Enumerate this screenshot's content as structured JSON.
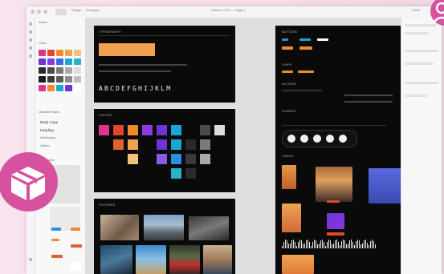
{
  "titlebar": {
    "tabs": [
      "Design",
      "Prototype"
    ],
    "document_title": "Outline UI Kit — Page 1",
    "zoom": "100%"
  },
  "left_panel": {
    "header": "Assets",
    "section_colors": "Colors",
    "section_text": "Character Styles",
    "text_samples": [
      "Body Copy",
      "Heading",
      "Subheading",
      "Caption"
    ],
    "section_components": "Components"
  },
  "boards": {
    "typography": {
      "title": "TYPOGRAPHY",
      "glyphs": "ABCDEFGHIJKLM"
    },
    "colors": {
      "title": "COLORS"
    },
    "pictures": {
      "title": "PICTURES"
    },
    "components": {
      "title": "BUTTONS",
      "sub1": "CHIPS",
      "sub2": "ACTIONS",
      "sub3": "SLIDERS",
      "sub4": "CARDS"
    }
  },
  "colors": {
    "accent": "#f0a252",
    "pink": "#e0338a",
    "red": "#e0462e",
    "orange": "#f08a2a",
    "purple": "#6a34d6",
    "violet": "#8a3ae0",
    "cyan": "#19a7d8",
    "badge": "#d6519e"
  },
  "icons": {
    "left_badge": "package-box-icon",
    "right_badge": "user-icon"
  }
}
